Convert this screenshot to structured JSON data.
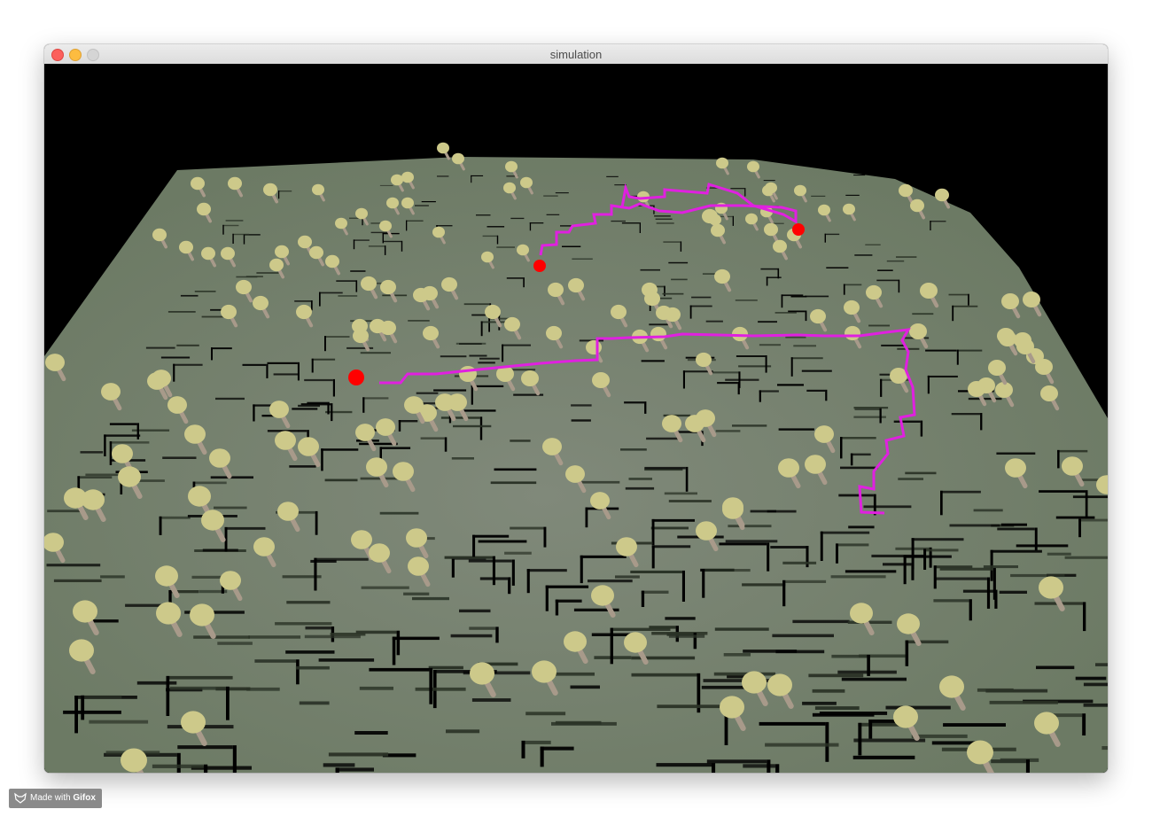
{
  "window": {
    "title": "simulation"
  },
  "scene": {
    "sky_color": "#000000",
    "terrain_color": "#6c7a64",
    "terrain_center_color": "#80897a",
    "tile_edge_color": "#2a3226",
    "tree_canopy_color": "#cdc98a",
    "tree_trunk_color": "#a89a8a",
    "path_color": "#e020e0",
    "waypoint_color": "#ff0000"
  },
  "badge": {
    "prefix": "Made with ",
    "brand": "Gifox",
    "icon": "fox-icon"
  }
}
